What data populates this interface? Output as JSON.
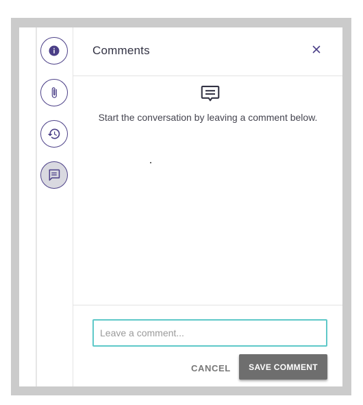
{
  "rail": {
    "items": [
      {
        "name": "info",
        "icon": "info-icon",
        "active": false
      },
      {
        "name": "attachments",
        "icon": "paperclip-icon",
        "active": false
      },
      {
        "name": "history",
        "icon": "history-icon",
        "active": false
      },
      {
        "name": "comments",
        "icon": "comment-icon",
        "active": true
      }
    ]
  },
  "panel": {
    "title": "Comments",
    "close_icon": "close-icon",
    "empty_state": {
      "icon": "comment-icon",
      "text": "Start the conversation by leaving a comment below."
    }
  },
  "composer": {
    "placeholder": "Leave a comment...",
    "value": "",
    "cancel_label": "CANCEL",
    "save_label": "SAVE COMMENT"
  },
  "colors": {
    "accent": "#4b3f87",
    "input_focus": "#5ec8c8",
    "save_button": "#6e6e6e"
  }
}
